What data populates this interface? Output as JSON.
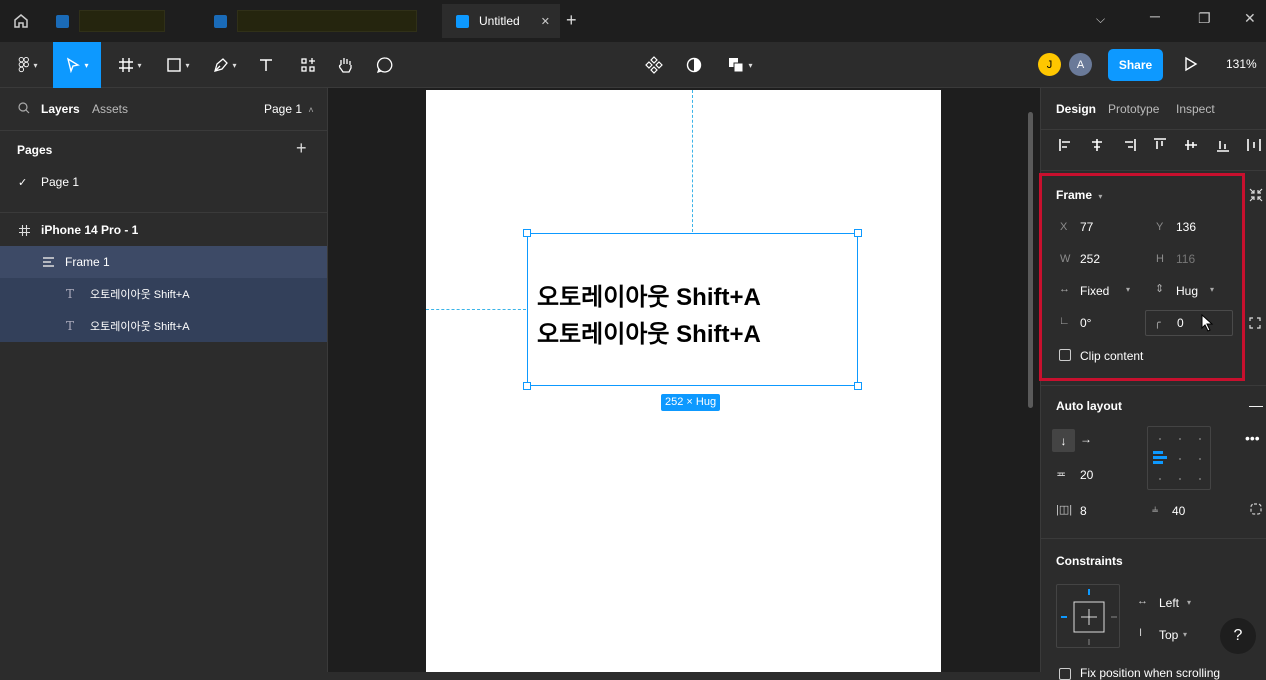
{
  "tabs": {
    "active_title": "Untitled",
    "add_label": "+"
  },
  "window": {
    "min": "─",
    "max": "❐",
    "close": "✕",
    "chevron": "⌄"
  },
  "toolbar": {
    "zoom": "131%",
    "share_label": "Share",
    "avatar_j": "J",
    "avatar_a": "A"
  },
  "left": {
    "tab_layers": "Layers",
    "tab_assets": "Assets",
    "page_selector": "Page 1",
    "pages_title": "Pages",
    "add_page": "+",
    "page_1": "Page 1",
    "layers": [
      {
        "label": "iPhone 14 Pro - 1",
        "icon": "frame-hash-icon"
      },
      {
        "label": "Frame 1",
        "icon": "auto-layout-icon"
      },
      {
        "label": "오토레이아웃 Shift+A",
        "icon": "text-icon"
      },
      {
        "label": "오토레이아웃 Shift+A",
        "icon": "text-icon"
      }
    ]
  },
  "canvas": {
    "text_line_1": "오토레이아웃 Shift+A",
    "text_line_2": "오토레이아웃 Shift+A",
    "size_badge": "252 × Hug"
  },
  "right": {
    "tab_design": "Design",
    "tab_prototype": "Prototype",
    "tab_inspect": "Inspect",
    "frame": {
      "title": "Frame",
      "x_label": "X",
      "x_value": "77",
      "y_label": "Y",
      "y_value": "136",
      "w_label": "W",
      "w_value": "252",
      "h_label": "H",
      "h_value": "116",
      "width_mode": "Fixed",
      "height_mode": "Hug",
      "rotation": "0°",
      "radius": "0",
      "clip_label": "Clip content"
    },
    "auto_layout": {
      "title": "Auto layout",
      "gap": "20",
      "padding_h": "8",
      "padding_v": "40"
    },
    "constraints": {
      "title": "Constraints",
      "horizontal": "Left",
      "vertical": "Top",
      "fix_position": "Fix position when scrolling"
    },
    "help": "?"
  },
  "colors": {
    "accent": "#0d99ff",
    "highlight_box": "#c8102e",
    "selection_row": "#3d4a66"
  }
}
